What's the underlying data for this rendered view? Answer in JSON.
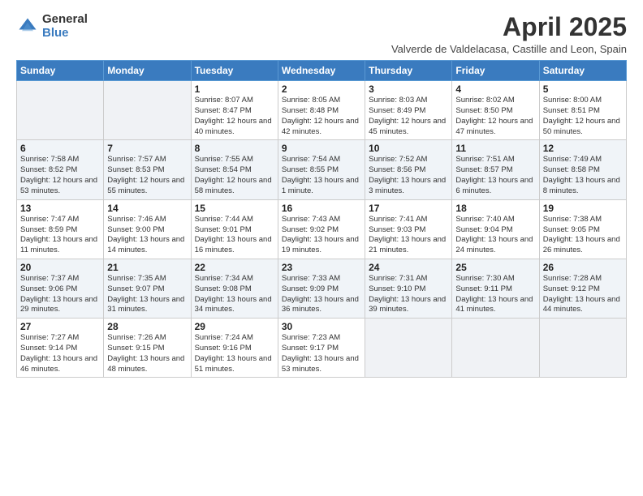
{
  "logo": {
    "general": "General",
    "blue": "Blue"
  },
  "title": "April 2025",
  "subtitle": "Valverde de Valdelacasa, Castille and Leon, Spain",
  "days_of_week": [
    "Sunday",
    "Monday",
    "Tuesday",
    "Wednesday",
    "Thursday",
    "Friday",
    "Saturday"
  ],
  "weeks": [
    [
      {
        "day": "",
        "info": ""
      },
      {
        "day": "",
        "info": ""
      },
      {
        "day": "1",
        "info": "Sunrise: 8:07 AM\nSunset: 8:47 PM\nDaylight: 12 hours and 40 minutes."
      },
      {
        "day": "2",
        "info": "Sunrise: 8:05 AM\nSunset: 8:48 PM\nDaylight: 12 hours and 42 minutes."
      },
      {
        "day": "3",
        "info": "Sunrise: 8:03 AM\nSunset: 8:49 PM\nDaylight: 12 hours and 45 minutes."
      },
      {
        "day": "4",
        "info": "Sunrise: 8:02 AM\nSunset: 8:50 PM\nDaylight: 12 hours and 47 minutes."
      },
      {
        "day": "5",
        "info": "Sunrise: 8:00 AM\nSunset: 8:51 PM\nDaylight: 12 hours and 50 minutes."
      }
    ],
    [
      {
        "day": "6",
        "info": "Sunrise: 7:58 AM\nSunset: 8:52 PM\nDaylight: 12 hours and 53 minutes."
      },
      {
        "day": "7",
        "info": "Sunrise: 7:57 AM\nSunset: 8:53 PM\nDaylight: 12 hours and 55 minutes."
      },
      {
        "day": "8",
        "info": "Sunrise: 7:55 AM\nSunset: 8:54 PM\nDaylight: 12 hours and 58 minutes."
      },
      {
        "day": "9",
        "info": "Sunrise: 7:54 AM\nSunset: 8:55 PM\nDaylight: 13 hours and 1 minute."
      },
      {
        "day": "10",
        "info": "Sunrise: 7:52 AM\nSunset: 8:56 PM\nDaylight: 13 hours and 3 minutes."
      },
      {
        "day": "11",
        "info": "Sunrise: 7:51 AM\nSunset: 8:57 PM\nDaylight: 13 hours and 6 minutes."
      },
      {
        "day": "12",
        "info": "Sunrise: 7:49 AM\nSunset: 8:58 PM\nDaylight: 13 hours and 8 minutes."
      }
    ],
    [
      {
        "day": "13",
        "info": "Sunrise: 7:47 AM\nSunset: 8:59 PM\nDaylight: 13 hours and 11 minutes."
      },
      {
        "day": "14",
        "info": "Sunrise: 7:46 AM\nSunset: 9:00 PM\nDaylight: 13 hours and 14 minutes."
      },
      {
        "day": "15",
        "info": "Sunrise: 7:44 AM\nSunset: 9:01 PM\nDaylight: 13 hours and 16 minutes."
      },
      {
        "day": "16",
        "info": "Sunrise: 7:43 AM\nSunset: 9:02 PM\nDaylight: 13 hours and 19 minutes."
      },
      {
        "day": "17",
        "info": "Sunrise: 7:41 AM\nSunset: 9:03 PM\nDaylight: 13 hours and 21 minutes."
      },
      {
        "day": "18",
        "info": "Sunrise: 7:40 AM\nSunset: 9:04 PM\nDaylight: 13 hours and 24 minutes."
      },
      {
        "day": "19",
        "info": "Sunrise: 7:38 AM\nSunset: 9:05 PM\nDaylight: 13 hours and 26 minutes."
      }
    ],
    [
      {
        "day": "20",
        "info": "Sunrise: 7:37 AM\nSunset: 9:06 PM\nDaylight: 13 hours and 29 minutes."
      },
      {
        "day": "21",
        "info": "Sunrise: 7:35 AM\nSunset: 9:07 PM\nDaylight: 13 hours and 31 minutes."
      },
      {
        "day": "22",
        "info": "Sunrise: 7:34 AM\nSunset: 9:08 PM\nDaylight: 13 hours and 34 minutes."
      },
      {
        "day": "23",
        "info": "Sunrise: 7:33 AM\nSunset: 9:09 PM\nDaylight: 13 hours and 36 minutes."
      },
      {
        "day": "24",
        "info": "Sunrise: 7:31 AM\nSunset: 9:10 PM\nDaylight: 13 hours and 39 minutes."
      },
      {
        "day": "25",
        "info": "Sunrise: 7:30 AM\nSunset: 9:11 PM\nDaylight: 13 hours and 41 minutes."
      },
      {
        "day": "26",
        "info": "Sunrise: 7:28 AM\nSunset: 9:12 PM\nDaylight: 13 hours and 44 minutes."
      }
    ],
    [
      {
        "day": "27",
        "info": "Sunrise: 7:27 AM\nSunset: 9:14 PM\nDaylight: 13 hours and 46 minutes."
      },
      {
        "day": "28",
        "info": "Sunrise: 7:26 AM\nSunset: 9:15 PM\nDaylight: 13 hours and 48 minutes."
      },
      {
        "day": "29",
        "info": "Sunrise: 7:24 AM\nSunset: 9:16 PM\nDaylight: 13 hours and 51 minutes."
      },
      {
        "day": "30",
        "info": "Sunrise: 7:23 AM\nSunset: 9:17 PM\nDaylight: 13 hours and 53 minutes."
      },
      {
        "day": "",
        "info": ""
      },
      {
        "day": "",
        "info": ""
      },
      {
        "day": "",
        "info": ""
      }
    ]
  ]
}
